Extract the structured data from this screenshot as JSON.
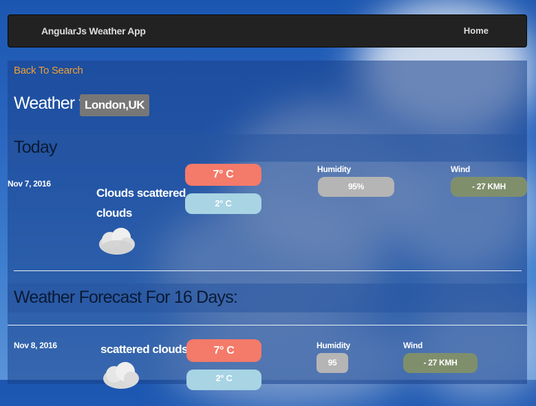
{
  "navbar": {
    "brand": "AngularJs Weather App",
    "home": "Home"
  },
  "back_link": "Back To Search",
  "weather_for_label": "Weather for",
  "city": "London,UK",
  "today": {
    "heading": "Today",
    "date": "Nov 7, 2016",
    "description_line1": "Clouds scattered",
    "description_line2": "clouds",
    "icon": "scattered-clouds-icon",
    "temp_max": "7° C",
    "temp_min": "2° C",
    "humidity_label": "Humidity",
    "humidity": "95%",
    "wind_label": "Wind",
    "wind": "- 27 KMH"
  },
  "forecast": {
    "heading": "Weather Forecast For 16 Days:",
    "items": [
      {
        "date": "Nov 8, 2016",
        "description": "scattered clouds",
        "icon": "scattered-clouds-icon",
        "temp_max": "7° C",
        "temp_min": "2° C",
        "humidity_label": "Humidity",
        "humidity": "95",
        "wind_label": "Wind",
        "wind": "- 27 KMH"
      }
    ]
  },
  "colors": {
    "navbar": "#222222",
    "link": "#f0a030",
    "temp_max": "#f47a6a",
    "temp_min": "#a8d4e4",
    "humidity": "#b5b5b5",
    "wind": "#7f8f6c"
  }
}
